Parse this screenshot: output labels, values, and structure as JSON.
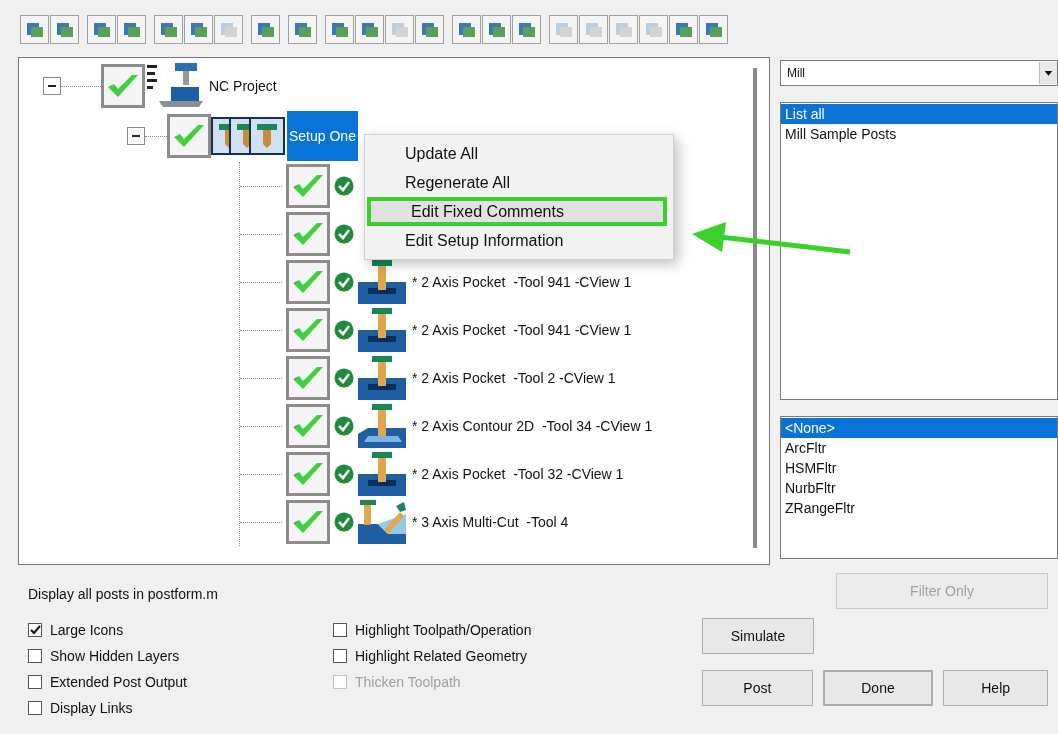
{
  "toolbar": [
    [
      {
        "disabled": false
      },
      {
        "disabled": false
      }
    ],
    [
      {
        "disabled": false
      },
      {
        "disabled": false
      }
    ],
    [
      {
        "disabled": false
      },
      {
        "disabled": false
      },
      {
        "disabled": true
      }
    ],
    [
      {
        "disabled": false
      }
    ],
    [
      {
        "disabled": false
      }
    ],
    [
      {
        "disabled": false
      },
      {
        "disabled": false
      },
      {
        "disabled": true
      },
      {
        "disabled": false
      }
    ],
    [
      {
        "disabled": false
      },
      {
        "disabled": false
      },
      {
        "disabled": false
      }
    ],
    [
      {
        "disabled": true
      },
      {
        "disabled": true
      },
      {
        "disabled": true
      },
      {
        "disabled": true
      },
      {
        "disabled": false
      },
      {
        "disabled": false
      }
    ]
  ],
  "tree": {
    "label": "NC Project",
    "checked": true,
    "expanded": true,
    "children": [
      {
        "label": "Setup One",
        "checked": true,
        "expanded": true,
        "selected": true,
        "children": [
          {
            "checked": true
          },
          {
            "checked": true
          },
          {
            "kind": "pocket",
            "checked": true,
            "label": "* 2 Axis Pocket  -Tool 941 -CView 1"
          },
          {
            "kind": "pocket",
            "checked": true,
            "label": "* 2 Axis Pocket  -Tool 941 -CView 1"
          },
          {
            "kind": "pocket",
            "checked": true,
            "label": "* 2 Axis Pocket  -Tool 2 -CView 1"
          },
          {
            "kind": "contour",
            "checked": true,
            "label": "* 2 Axis Contour 2D  -Tool 34 -CView 1"
          },
          {
            "kind": "pocket",
            "checked": true,
            "label": "* 2 Axis Pocket  -Tool 32 -CView 1"
          },
          {
            "kind": "multicut",
            "checked": true,
            "label": "* 3 Axis Multi-Cut  -Tool 4"
          }
        ]
      }
    ]
  },
  "context_menu": [
    {
      "label": "Update All",
      "selected": false
    },
    {
      "label": "Regenerate All",
      "selected": false
    },
    {
      "label": "Edit Fixed Comments",
      "selected": true
    },
    {
      "label": "Edit Setup Information",
      "selected": false
    }
  ],
  "machine_dropdown": {
    "value": "Mill"
  },
  "post_list": [
    {
      "label": "List all",
      "selected": true
    },
    {
      "label": "Mill Sample Posts",
      "selected": false
    }
  ],
  "filter_list": [
    {
      "label": "<None>",
      "selected": true
    },
    {
      "label": "ArcFltr",
      "selected": false
    },
    {
      "label": "HSMFltr",
      "selected": false
    },
    {
      "label": "NurbFltr",
      "selected": false
    },
    {
      "label": "ZRangeFltr",
      "selected": false
    }
  ],
  "status_text": "Display all posts in postform.m",
  "options_left": [
    {
      "label": "Large Icons",
      "checked": true,
      "disabled": false
    },
    {
      "label": "Show Hidden Layers",
      "checked": false,
      "disabled": false
    },
    {
      "label": "Extended Post Output",
      "checked": false,
      "disabled": false
    },
    {
      "label": "Display Links",
      "checked": false,
      "disabled": false
    }
  ],
  "options_right": [
    {
      "label": "Highlight Toolpath/Operation",
      "checked": false,
      "disabled": false
    },
    {
      "label": "Highlight Related Geometry",
      "checked": false,
      "disabled": false
    },
    {
      "label": "Thicken Toolpath",
      "checked": false,
      "disabled": true
    }
  ],
  "buttons": {
    "filter_only": {
      "label": "Filter Only",
      "disabled": true
    },
    "simulate": {
      "label": "Simulate"
    },
    "post": {
      "label": "Post"
    },
    "done": {
      "label": "Done",
      "default": true
    },
    "help": {
      "label": "Help"
    }
  }
}
